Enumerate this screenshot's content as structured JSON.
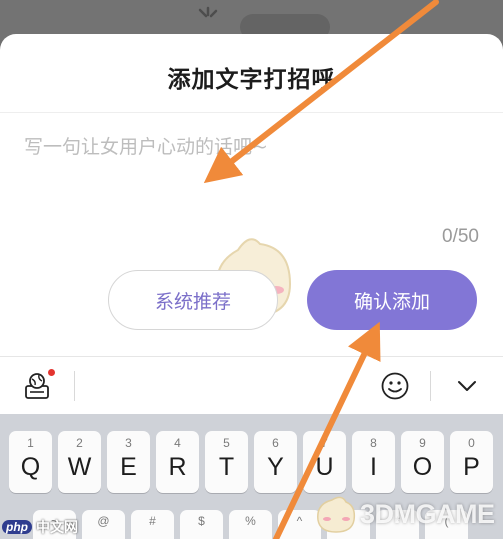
{
  "dialog": {
    "title": "添加文字打招呼",
    "placeholder": "写一句让女用户心动的话吧~",
    "counter": "0/50",
    "suggest_button": "系统推荐",
    "confirm_button": "确认添加"
  },
  "colors": {
    "accent": "#8276d6",
    "arrow": "#f08a3a",
    "overlay": "#6f6f6f"
  },
  "keyboard": {
    "top_row": [
      {
        "num": "1",
        "letter": "Q"
      },
      {
        "num": "2",
        "letter": "W"
      },
      {
        "num": "3",
        "letter": "E"
      },
      {
        "num": "4",
        "letter": "R"
      },
      {
        "num": "5",
        "letter": "T"
      },
      {
        "num": "6",
        "letter": "Y"
      },
      {
        "num": "7",
        "letter": "U"
      },
      {
        "num": "8",
        "letter": "I"
      },
      {
        "num": "9",
        "letter": "O"
      },
      {
        "num": "0",
        "letter": "P"
      }
    ],
    "second_row_symbols": [
      "~",
      "@",
      "#",
      "$",
      "%",
      "^",
      "&",
      "*",
      "(",
      ")"
    ],
    "toolbar_icons": [
      "keyboard-globe-icon",
      "emoji-icon",
      "collapse-chevron-icon"
    ]
  },
  "watermarks": {
    "php_logo": "php",
    "php_text": "中文网",
    "site": "3DMGAME"
  }
}
